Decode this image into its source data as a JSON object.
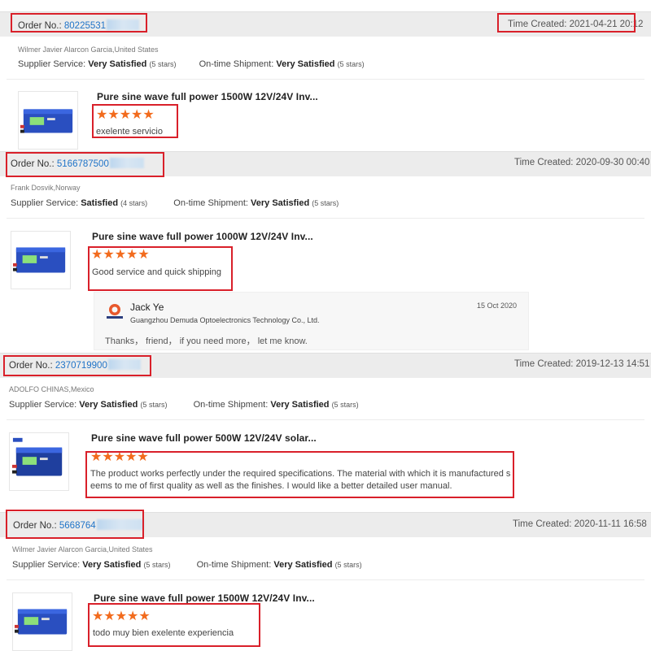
{
  "colors": {
    "accent": "#1e73c8",
    "star": "#f26b1d",
    "highlight": "#d9202a",
    "bar": "#ececec"
  },
  "labels": {
    "order_no": "Order No.:",
    "time_created": "Time Created:",
    "supplier_service": "Supplier Service:",
    "on_time_shipment": "On-time Shipment:"
  },
  "reviews": [
    {
      "order_no": "80225531",
      "time_created": "2021-04-21 20:12",
      "buyer": "Wilmer Javier Alarcon Garcia,United States",
      "supplier_rating": "Very Satisfied",
      "supplier_stars": "(5 stars)",
      "shipment_rating": "Very Satisfied",
      "shipment_stars": "(5 stars)",
      "product_title": "Pure sine wave full power 1500W 12V/24V Inv...",
      "stars": "★★★★★",
      "rating": 5,
      "comment": "exelente servicio"
    },
    {
      "order_no": "5166787500",
      "time_created": "2020-09-30 00:40",
      "buyer": "Frank Dosvik,Norway",
      "supplier_rating": "Satisfied",
      "supplier_stars": "(4 stars)",
      "shipment_rating": "Very Satisfied",
      "shipment_stars": "(5 stars)",
      "product_title": "Pure sine wave full power 1000W 12V/24V Inv...",
      "stars": "★★★★★",
      "rating": 5,
      "comment": "Good service and quick shipping",
      "reply": {
        "name": "Jack Ye",
        "company": "Guangzhou Demuda Optoelectronics Technology Co., Ltd.",
        "date": "15 Oct 2020",
        "text": "Thanks， friend，  if you need more，  let  me know."
      }
    },
    {
      "order_no": "2370719900",
      "time_created": "2019-12-13 14:51",
      "buyer": "ADOLFO CHINAS,Mexico",
      "supplier_rating": "Very Satisfied",
      "supplier_stars": "(5 stars)",
      "shipment_rating": "Very Satisfied",
      "shipment_stars": "(5 stars)",
      "product_title": "Pure sine wave full power 500W 12V/24V solar...",
      "stars": "★★★★★",
      "rating": 5,
      "comment_line1": "The product works perfectly under the required specifications. The material with which it is manufactured s",
      "comment_line2": "eems to me of first quality as well as the finishes. I would like a better detailed user manual."
    },
    {
      "order_no": "5668764",
      "time_created": "2020-11-11 16:58",
      "buyer": "Wilmer Javier Alarcon Garcia,United States",
      "supplier_rating": "Very Satisfied",
      "supplier_stars": "(5 stars)",
      "shipment_rating": "Very Satisfied",
      "shipment_stars": "(5 stars)",
      "product_title": "Pure sine wave full power 1500W 12V/24V Inv...",
      "stars": "★★★★★",
      "rating": 5,
      "comment": "todo muy bien exelente experiencia"
    }
  ]
}
